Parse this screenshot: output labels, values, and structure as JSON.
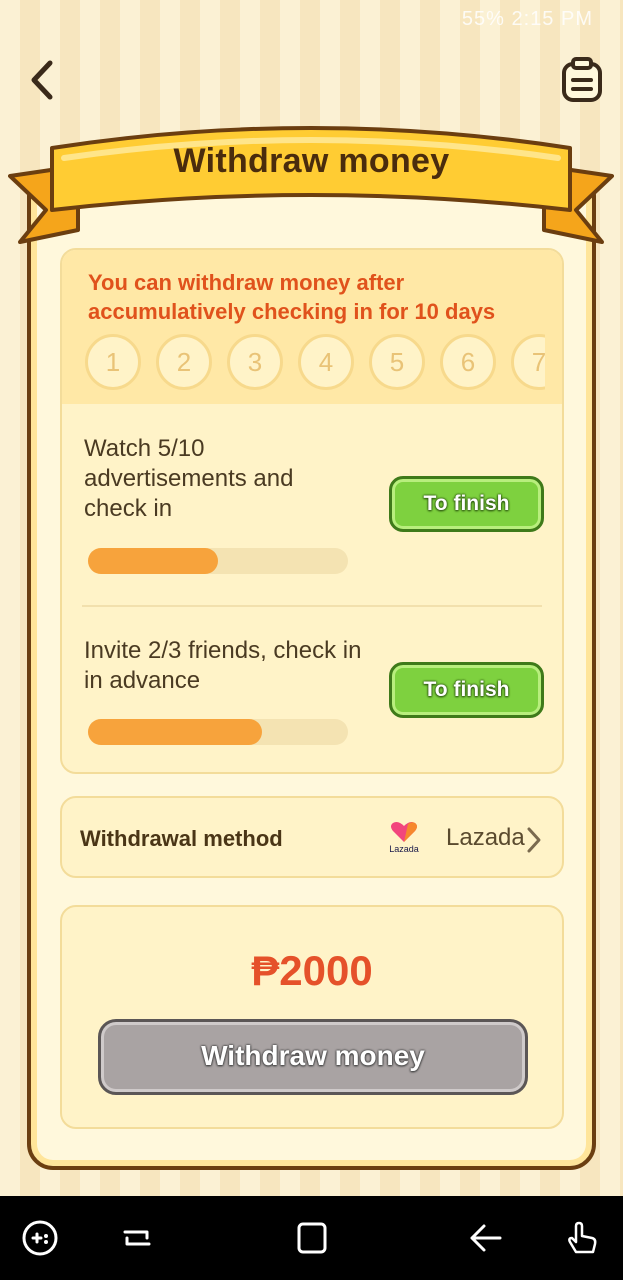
{
  "status_bar": {
    "text": "55% 2:15 PM"
  },
  "header": {
    "title": "Withdraw money",
    "back_icon": "chevron-left-icon",
    "records_icon": "clipboard-icon"
  },
  "notice": "You can withdraw money after accumulatively checking in for 10 days",
  "days": [
    "1",
    "2",
    "3",
    "4",
    "5",
    "6",
    "7"
  ],
  "tasks": [
    {
      "label": "Watch 5/10 advertisements and check in",
      "button": "To finish",
      "progress": 0.5
    },
    {
      "label": "Invite 2/3 friends, check in in advance",
      "button": "To finish",
      "progress": 0.67
    }
  ],
  "withdrawal_method": {
    "label": "Withdrawal method",
    "logo_text": "Lazada",
    "value": "Lazada"
  },
  "amount": "₱2000",
  "withdraw_button": "Withdraw money",
  "colors": {
    "accent": "#e5512a",
    "button_green": "#7ed13f",
    "progress": "#f7a33c",
    "ribbon": "#ffcc33"
  },
  "nav_bar": {
    "icons": [
      "game-tools-icon",
      "recent-apps-icon",
      "home-icon",
      "back-icon",
      "gesture-icon"
    ]
  }
}
